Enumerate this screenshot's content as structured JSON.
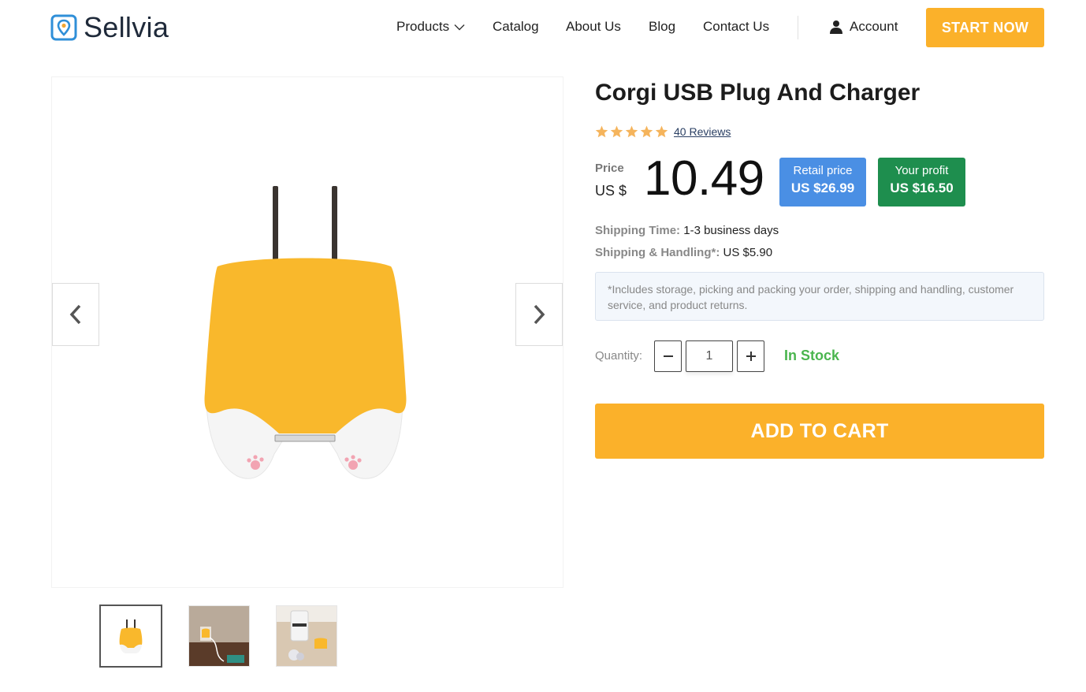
{
  "header": {
    "logo_text": "Sellvia",
    "nav": {
      "products": "Products",
      "catalog": "Catalog",
      "about": "About Us",
      "blog": "Blog",
      "contact": "Contact Us",
      "account": "Account"
    },
    "start_button": "START NOW"
  },
  "gallery": {
    "thumbnails": [
      "charger-front",
      "charger-on-wall",
      "charger-on-desk"
    ],
    "active_index": 0
  },
  "product": {
    "title": "Corgi USB Plug And Charger",
    "rating": 5,
    "reviews_link": "40 Reviews",
    "price_label": "Price",
    "price_currency": "US $",
    "price_value": "10.49",
    "retail_label": "Retail price",
    "retail_value": "US $26.99",
    "profit_label": "Your profit",
    "profit_value": "US $16.50",
    "shipping_time_label": "Shipping Time:",
    "shipping_time_value": "1-3 business days",
    "shipping_handling_label": "Shipping & Handling*:",
    "shipping_handling_value": "US $5.90",
    "note": "*Includes storage, picking and packing your order, shipping and handling, customer service, and product returns.",
    "quantity_label": "Quantity:",
    "quantity_value": "1",
    "stock_status": "In Stock",
    "add_to_cart": "ADD TO CART"
  },
  "colors": {
    "accent_orange": "#fbb12a",
    "retail_blue": "#4a8fe4",
    "profit_green": "#1e8e4e",
    "stock_green": "#4ab54e",
    "star": "#f5b45c"
  }
}
